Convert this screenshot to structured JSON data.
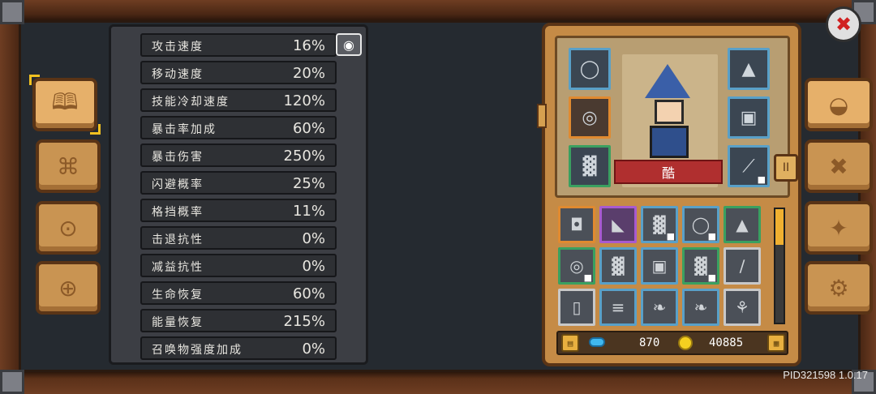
{
  "stats": [
    {
      "label": "攻击速度",
      "value": "16%"
    },
    {
      "label": "移动速度",
      "value": "20%"
    },
    {
      "label": "技能冷却速度",
      "value": "120%"
    },
    {
      "label": "暴击率加成",
      "value": "60%"
    },
    {
      "label": "暴击伤害",
      "value": "250%"
    },
    {
      "label": "闪避概率",
      "value": "25%"
    },
    {
      "label": "格挡概率",
      "value": "11%"
    },
    {
      "label": "击退抗性",
      "value": "0%"
    },
    {
      "label": "减益抗性",
      "value": "0%"
    },
    {
      "label": "生命恢复",
      "value": "60%"
    },
    {
      "label": "能量恢复",
      "value": "215%"
    },
    {
      "label": "召唤物强度加成",
      "value": "0%"
    }
  ],
  "character": {
    "name": "酷"
  },
  "currency": {
    "gems": "870",
    "coins": "40885"
  },
  "side_tab_label": "II",
  "footer": {
    "version": "PID321598 1.0.17"
  },
  "colors": {
    "panel_wood": "#c58b46",
    "stats_bg": "#3c3e44",
    "ribbon_red": "#b02f2f",
    "scroll_thumb": "#f0b030"
  },
  "icons": {
    "left_tabs": [
      "book-icon",
      "map-icon",
      "orbs-icon",
      "steering-wheel-icon"
    ],
    "right_tabs": [
      "helmet-icon",
      "crossed-arrows-icon",
      "compass-icon",
      "gear-icon"
    ]
  }
}
